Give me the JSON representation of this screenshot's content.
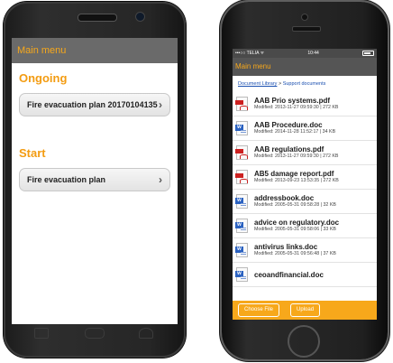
{
  "android": {
    "app_title": "Main menu",
    "sections": [
      {
        "title": "Ongoing",
        "items": [
          {
            "label": "Fire evacuation plan 20170104135"
          }
        ]
      },
      {
        "title": "Start",
        "items": [
          {
            "label": "Fire evacuation plan"
          }
        ]
      }
    ],
    "chevron": "›"
  },
  "iphone": {
    "status": {
      "carrier": "•••○○ TELIA ᯤ",
      "time": "10:44"
    },
    "app_title": "Main menu",
    "breadcrumb": {
      "root": "Document Library",
      "separator": ">",
      "current": "Support documents"
    },
    "files": [
      {
        "name": "AAB Prio systems.pdf",
        "meta": "Modified: 2013-11-27 09:59:30 | 272 KB",
        "type": "pdf"
      },
      {
        "name": "AAB Procedure.doc",
        "meta": "Modified: 2014-11-28 11:52:17 | 34 KB",
        "type": "doc"
      },
      {
        "name": "AAB regulations.pdf",
        "meta": "Modified: 2013-11-27 09:59:30 | 272 KB",
        "type": "pdf"
      },
      {
        "name": "AB5 damage report.pdf",
        "meta": "Modified: 2013-09-23 13:53:35 | 272 KB",
        "type": "pdf"
      },
      {
        "name": "addressbook.doc",
        "meta": "Modified: 2005-05-31 09:58:28 | 32 KB",
        "type": "doc"
      },
      {
        "name": "advice on regulatory.doc",
        "meta": "Modified: 2005-05-31 09:58:06 | 33 KB",
        "type": "doc"
      },
      {
        "name": "antivirus links.doc",
        "meta": "Modified: 2005-05-31 09:56:48 | 37 KB",
        "type": "doc"
      },
      {
        "name": "ceoandfinancial.doc",
        "meta": "",
        "type": "doc"
      }
    ],
    "buttons": {
      "choose": "Choose File",
      "upload": "Upload"
    },
    "colors": {
      "accent": "#f7a81b",
      "appbar": "#555555"
    }
  }
}
